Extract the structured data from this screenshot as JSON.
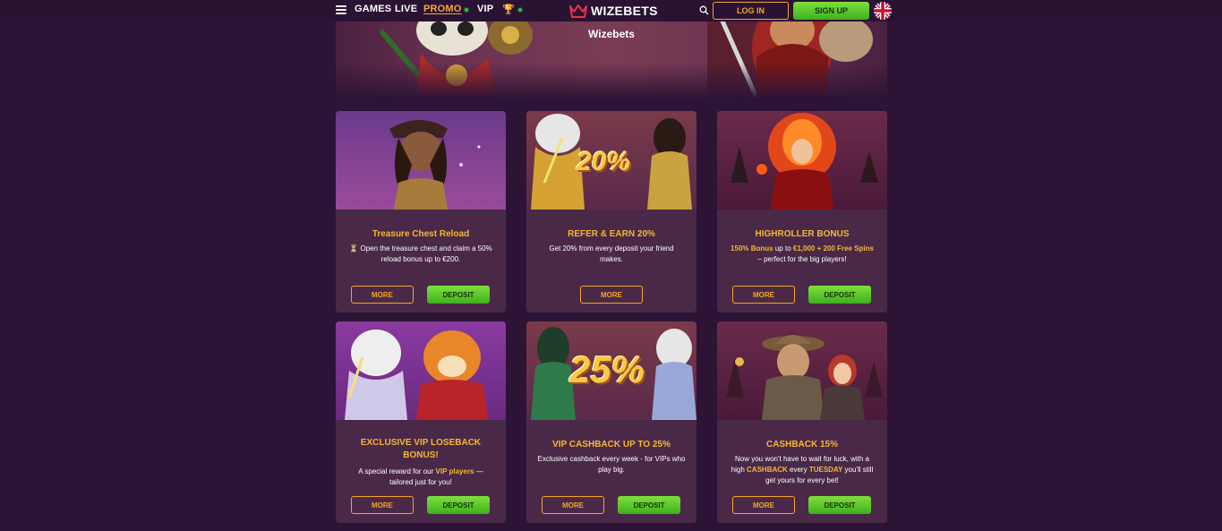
{
  "header": {
    "nav": {
      "games": "GAMES",
      "live": "LIVE",
      "promo": "PROMO",
      "vip": "VIP"
    },
    "logo_text": "WIZEBETS",
    "login_label": "LOG IN",
    "signup_label": "SIGN UP",
    "language_icon": "uk-flag-icon"
  },
  "hero": {
    "title": "Wizebets"
  },
  "promos": [
    {
      "title": "Treasure Chest Reload",
      "desc_icon": "⏳",
      "description": "Open the treasure chest and claim a 50% reload bonus up to €200.",
      "more_label": "MORE",
      "deposit_label": "DEPOSIT"
    },
    {
      "title": "REFER & EARN 20%",
      "art_text": "20%",
      "description": "Get 20% from every deposit your friend makes.",
      "more_label": "MORE"
    },
    {
      "title": "HIGHROLLER BONUS",
      "description_highlight_1": "150% Bonus",
      "description_text_1": " up to ",
      "description_highlight_2": "€1,000 + 200 Free Spins",
      "description_text_2": " – perfect for the big players!",
      "more_label": "MORE",
      "deposit_label": "DEPOSIT"
    },
    {
      "title": "EXCLUSIVE VIP LOSEBACK BONUS!",
      "description_text_1": "A special reward for our ",
      "description_highlight_1": "VIP players",
      "description_text_2": " — tailored just for you!",
      "more_label": "MORE",
      "deposit_label": "DEPOSIT"
    },
    {
      "title": "VIP CASHBACK UP TO 25%",
      "art_text": "25%",
      "description": "Exclusive cashback every week - for VIPs who play big.",
      "more_label": "MORE",
      "deposit_label": "DEPOSIT"
    },
    {
      "title": "CASHBACK 15%",
      "description_text_1": "Now you won't have to wait for luck, with a high ",
      "description_highlight_1": "CASHBACK",
      "description_text_2": " every ",
      "description_highlight_2": "TUESDAY",
      "description_text_3": " you'll still get yours for every bet!",
      "more_label": "MORE",
      "deposit_label": "DEPOSIT"
    }
  ],
  "colors": {
    "accent": "#f7b731",
    "green": "#5cc72b",
    "background": "#2d1436",
    "card": "#4a2948"
  }
}
